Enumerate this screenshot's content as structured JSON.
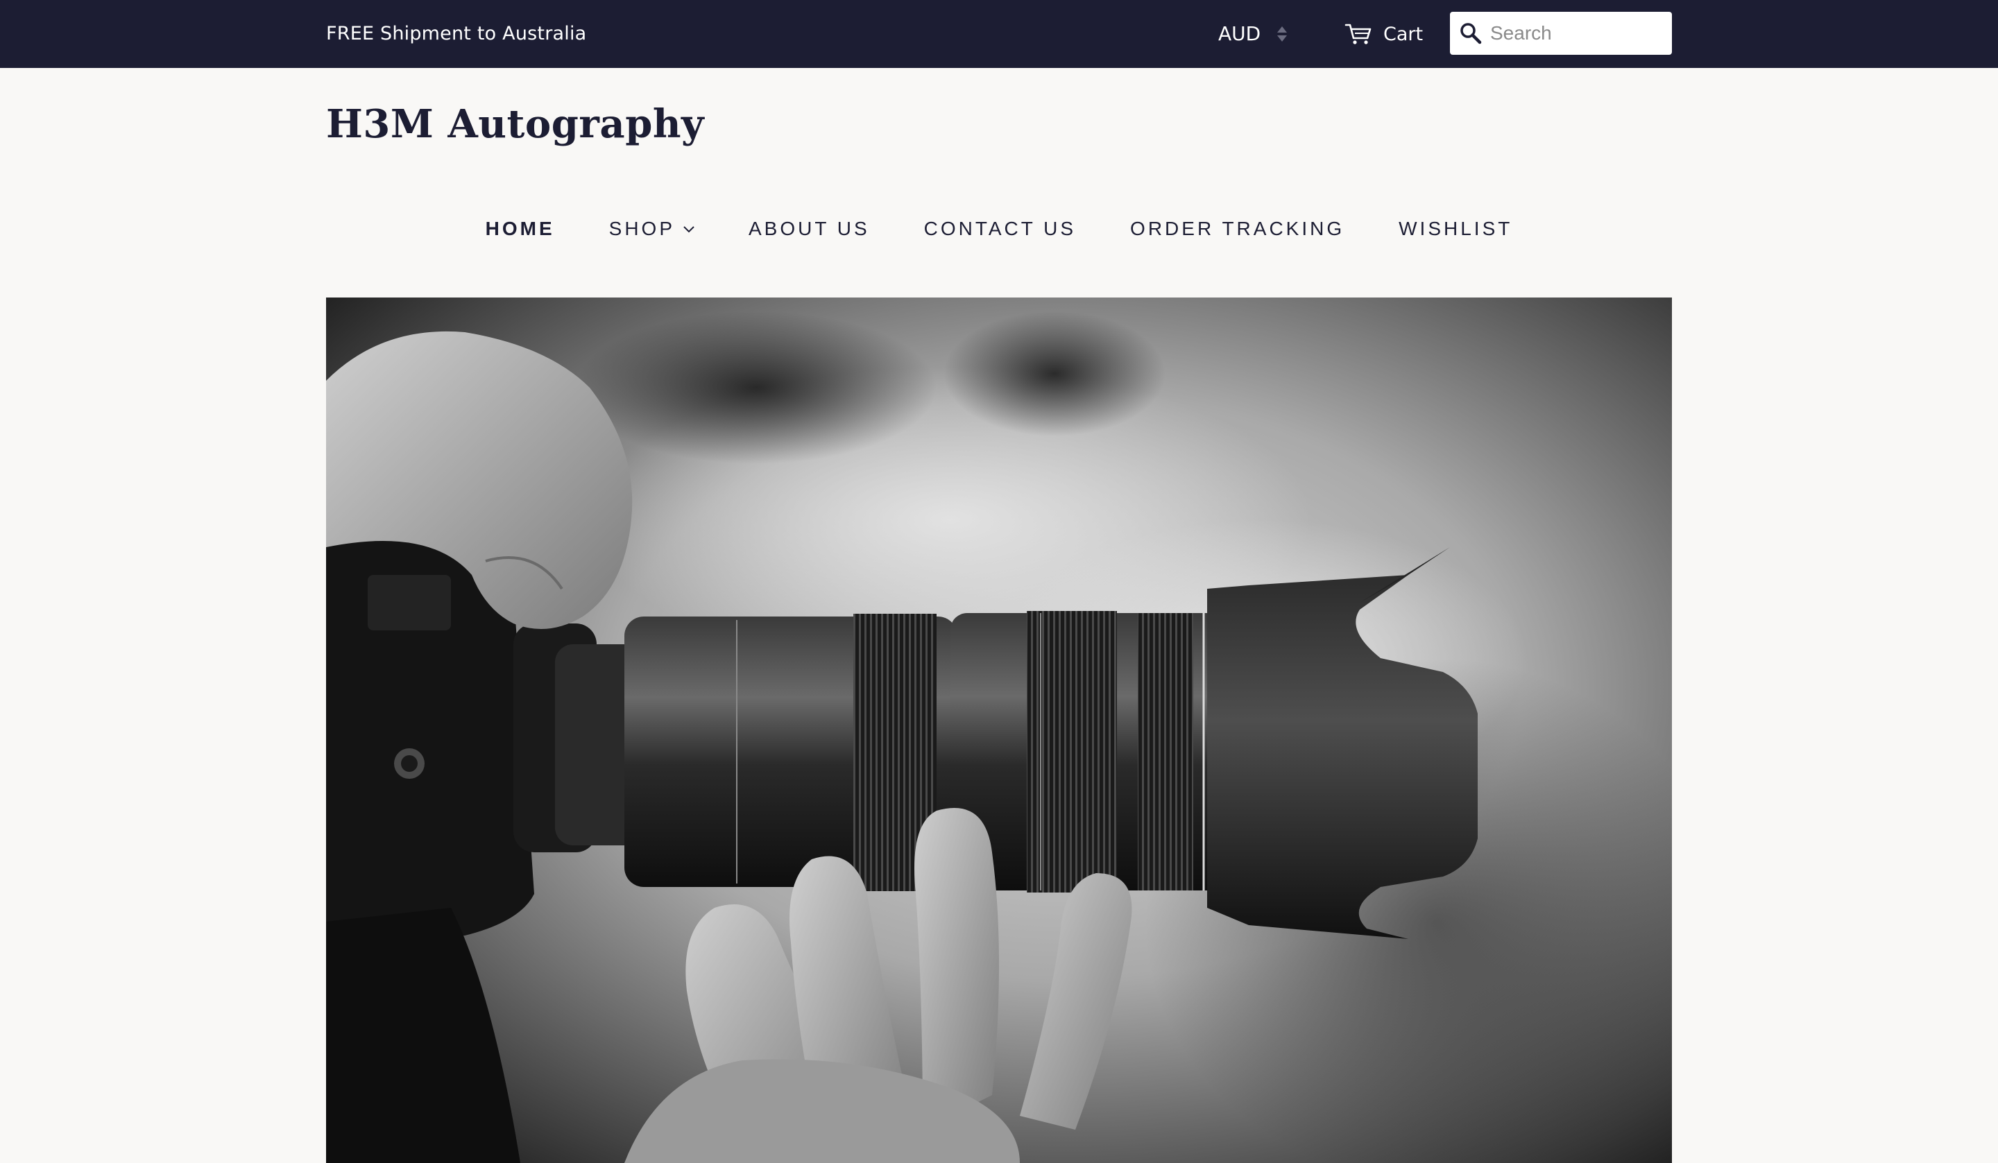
{
  "topbar": {
    "announcement": "FREE Shipment to Australia",
    "currency": "AUD",
    "cart_label": "Cart",
    "search_placeholder": "Search",
    "background": "#1c1d33"
  },
  "header": {
    "logo": "H3M Autography"
  },
  "nav": {
    "items": [
      {
        "label": "HOME",
        "active": true
      },
      {
        "label": "SHOP",
        "dropdown": true
      },
      {
        "label": "ABOUT US"
      },
      {
        "label": "CONTACT US"
      },
      {
        "label": "ORDER TRACKING"
      },
      {
        "label": "WISHLIST"
      }
    ]
  },
  "hero": {
    "image": "black-and-white photo of hands holding a camera with telephoto lens"
  },
  "icons": {
    "cart": "cart-icon",
    "search": "search-icon",
    "dropdown": "chevron-down-icon",
    "currency_select": "select-arrows-icon"
  }
}
